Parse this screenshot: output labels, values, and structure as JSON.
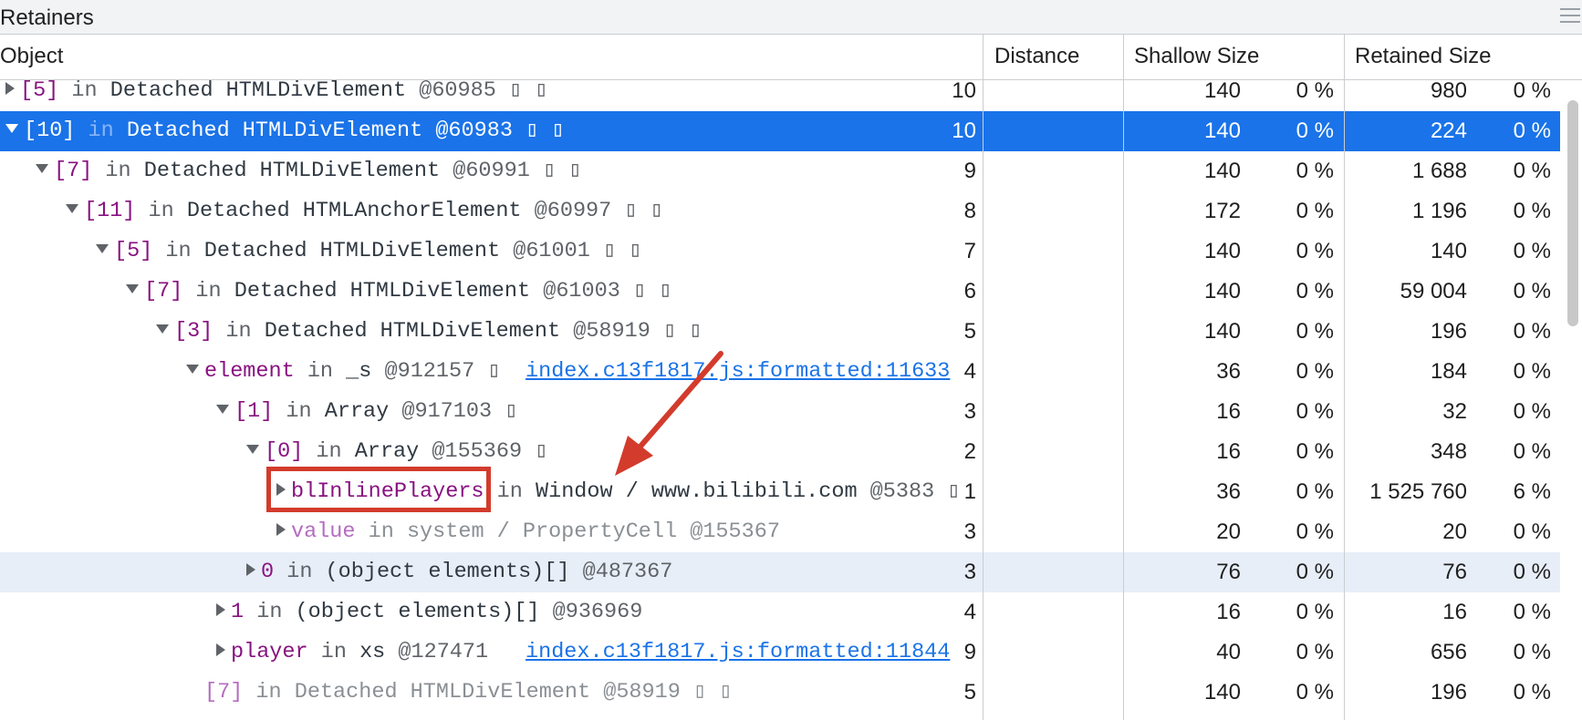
{
  "panel": {
    "title": "Retainers"
  },
  "columns": {
    "object": "Object",
    "distance": "Distance",
    "shallow": "Shallow Size",
    "retained": "Retained Size"
  },
  "rows": [
    {
      "indent": 0,
      "expander": "right",
      "name": "[5]",
      "kw": "in",
      "cls": "Detached HTMLDivElement",
      "oid": "@60985",
      "glyphs": "▯ ▯",
      "link": "",
      "distance": "10",
      "shallow": "140",
      "shallow_pct": "0 %",
      "retained": "980",
      "retained_pct": "0 %",
      "state": ""
    },
    {
      "indent": 0,
      "expander": "down",
      "name": "[10]",
      "kw": "in",
      "cls": "Detached HTMLDivElement",
      "oid": "@60983",
      "glyphs": "▯ ▯",
      "link": "",
      "distance": "10",
      "shallow": "140",
      "shallow_pct": "0 %",
      "retained": "224",
      "retained_pct": "0 %",
      "state": "selected"
    },
    {
      "indent": 1,
      "expander": "down",
      "name": "[7]",
      "kw": "in",
      "cls": "Detached HTMLDivElement",
      "oid": "@60991",
      "glyphs": "▯ ▯",
      "link": "",
      "distance": "9",
      "shallow": "140",
      "shallow_pct": "0 %",
      "retained": "1 688",
      "retained_pct": "0 %",
      "state": ""
    },
    {
      "indent": 2,
      "expander": "down",
      "name": "[11]",
      "kw": "in",
      "cls": "Detached HTMLAnchorElement",
      "oid": "@60997",
      "glyphs": "▯ ▯",
      "link": "",
      "distance": "8",
      "shallow": "172",
      "shallow_pct": "0 %",
      "retained": "1 196",
      "retained_pct": "0 %",
      "state": ""
    },
    {
      "indent": 3,
      "expander": "down",
      "name": "[5]",
      "kw": "in",
      "cls": "Detached HTMLDivElement",
      "oid": "@61001",
      "glyphs": "▯ ▯",
      "link": "",
      "distance": "7",
      "shallow": "140",
      "shallow_pct": "0 %",
      "retained": "140",
      "retained_pct": "0 %",
      "state": ""
    },
    {
      "indent": 4,
      "expander": "down",
      "name": "[7]",
      "kw": "in",
      "cls": "Detached HTMLDivElement",
      "oid": "@61003",
      "glyphs": "▯ ▯",
      "link": "",
      "distance": "6",
      "shallow": "140",
      "shallow_pct": "0 %",
      "retained": "59 004",
      "retained_pct": "0 %",
      "state": ""
    },
    {
      "indent": 5,
      "expander": "down",
      "name": "[3]",
      "kw": "in",
      "cls": "Detached HTMLDivElement",
      "oid": "@58919",
      "glyphs": "▯ ▯",
      "link": "",
      "distance": "5",
      "shallow": "140",
      "shallow_pct": "0 %",
      "retained": "196",
      "retained_pct": "0 %",
      "state": ""
    },
    {
      "indent": 6,
      "expander": "down",
      "name": "element",
      "kw": "in",
      "cls": "_s",
      "oid": "@912157",
      "glyphs": "▯",
      "link": "index.c13f1817.js:formatted:11633",
      "distance": "4",
      "shallow": "36",
      "shallow_pct": "0 %",
      "retained": "184",
      "retained_pct": "0 %",
      "state": ""
    },
    {
      "indent": 7,
      "expander": "down",
      "name": "[1]",
      "kw": "in",
      "cls": "Array",
      "oid": "@917103",
      "glyphs": "▯",
      "link": "",
      "distance": "3",
      "shallow": "16",
      "shallow_pct": "0 %",
      "retained": "32",
      "retained_pct": "0 %",
      "state": ""
    },
    {
      "indent": 8,
      "expander": "down",
      "name": "[0]",
      "kw": "in",
      "cls": "Array",
      "oid": "@155369",
      "glyphs": "▯",
      "link": "",
      "distance": "2",
      "shallow": "16",
      "shallow_pct": "0 %",
      "retained": "348",
      "retained_pct": "0 %",
      "state": ""
    },
    {
      "indent": 9,
      "expander": "right",
      "name": "blInlinePlayers",
      "kw": "in",
      "cls": "Window / www.bilibili.com",
      "oid": "@5383",
      "glyphs": "▯",
      "link": "",
      "distance": "1",
      "shallow": "36",
      "shallow_pct": "0 %",
      "retained": "1 525 760",
      "retained_pct": "6 %",
      "state": ""
    },
    {
      "indent": 9,
      "expander": "right",
      "name": "value",
      "kw": "in",
      "cls": "system / PropertyCell",
      "oid": "@155367",
      "glyphs": "",
      "link": "",
      "distance": "3",
      "shallow": "20",
      "shallow_pct": "0 %",
      "retained": "20",
      "retained_pct": "0 %",
      "state": "dim"
    },
    {
      "indent": 8,
      "expander": "right",
      "name": "0",
      "kw": "in",
      "cls": "(object elements)[]",
      "oid": "@487367",
      "glyphs": "",
      "link": "",
      "distance": "3",
      "shallow": "76",
      "shallow_pct": "0 %",
      "retained": "76",
      "retained_pct": "0 %",
      "state": "hover"
    },
    {
      "indent": 7,
      "expander": "right",
      "name": "1",
      "kw": "in",
      "cls": "(object elements)[]",
      "oid": "@936969",
      "glyphs": "",
      "link": "",
      "distance": "4",
      "shallow": "16",
      "shallow_pct": "0 %",
      "retained": "16",
      "retained_pct": "0 %",
      "state": ""
    },
    {
      "indent": 7,
      "expander": "right",
      "name": "player",
      "kw": "in",
      "cls": "xs",
      "oid": "@127471",
      "glyphs": "",
      "link": "index.c13f1817.js:formatted:11844",
      "distance": "9",
      "shallow": "40",
      "shallow_pct": "0 %",
      "retained": "656",
      "retained_pct": "0 %",
      "state": ""
    },
    {
      "indent": 6,
      "expander": "none",
      "name": "[7]",
      "kw": "in",
      "cls": "Detached HTMLDivElement",
      "oid": "@58919",
      "glyphs": "▯ ▯",
      "link": "",
      "distance": "5",
      "shallow": "140",
      "shallow_pct": "0 %",
      "retained": "196",
      "retained_pct": "0 %",
      "state": "dim"
    }
  ],
  "colors": {
    "selected_row": "#1a73e8",
    "hover_row": "#e8eef8",
    "annotation": "#d33b2c",
    "link": "#1a73e8",
    "property_name": "#881280"
  },
  "annotation": {
    "target": "blInlinePlayers",
    "shape": "red box with arrow"
  }
}
